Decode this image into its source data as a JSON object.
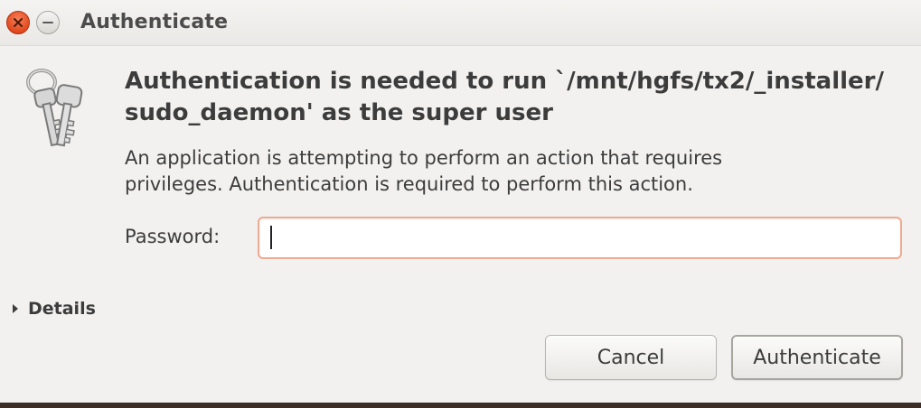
{
  "window": {
    "title": "Authenticate",
    "close_icon": "close-icon",
    "minimize_icon": "minimize-icon"
  },
  "dialog": {
    "icon": "keys-icon",
    "heading_line1": "Authentication is needed to run `/mnt/hgfs/tx2/_installer/",
    "heading_line2": "sudo_daemon' as the super user",
    "description_line1": "An application is attempting to perform an action that requires",
    "description_line2": "privileges. Authentication is required to perform this action.",
    "password_label": "Password:",
    "password_value": "",
    "details_label": "Details",
    "cancel_label": "Cancel",
    "authenticate_label": "Authenticate"
  },
  "colors": {
    "close_button": "#e3491d",
    "input_focus_border": "#efaa90",
    "dialog_background": "#f2f1f0"
  }
}
